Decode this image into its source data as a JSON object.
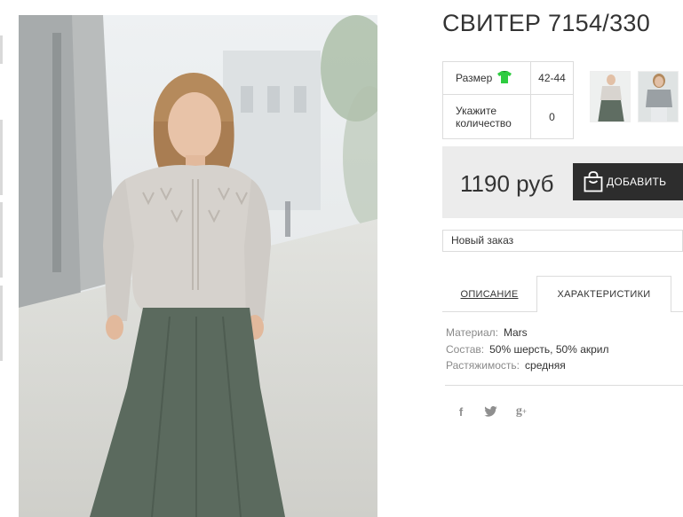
{
  "product": {
    "title": "СВИТЕР 7154/330"
  },
  "options": {
    "size_label": "Размер",
    "size_value": "42-44",
    "quantity_label": "Укажите количество",
    "quantity_value": "0"
  },
  "purchase": {
    "price": "1190 руб",
    "add_button_label": "ДОБАВИТЬ",
    "order_select_value": "Новый заказ"
  },
  "tabs": {
    "description": "ОПИСАНИЕ",
    "characteristics": "ХАРАКТЕРИСТИКИ",
    "active": "characteristics"
  },
  "specs": [
    {
      "key": "Материал:",
      "value": "Mars"
    },
    {
      "key": "Состав:",
      "value": "50% шерсть, 50% акрил"
    },
    {
      "key": "Растяжимость:",
      "value": "средняя"
    }
  ],
  "social": [
    {
      "name": "facebook",
      "glyph": "f"
    },
    {
      "name": "twitter",
      "glyph": "twitter-bird"
    },
    {
      "name": "google-plus",
      "glyph": "g+"
    }
  ],
  "colors": {
    "accent_dark": "#2d2d2d",
    "price_bg": "#ececec",
    "size_icon": "#2ecc40",
    "border": "#dcdcdc"
  }
}
